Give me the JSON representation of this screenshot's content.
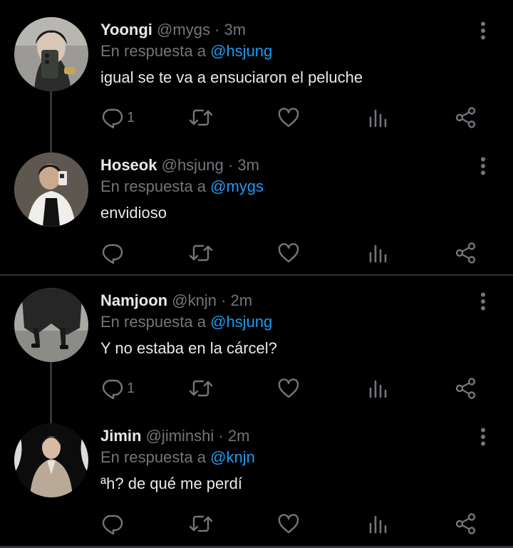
{
  "tweets": [
    {
      "name": "Yoongi",
      "handle": "@mygs",
      "dot": "·",
      "time": "3m",
      "reply_prefix": "En respuesta a",
      "reply_to": "@hsjung",
      "text": "igual se te va a ensuciaron el peluche",
      "reply_count": "1"
    },
    {
      "name": "Hoseok",
      "handle": "@hsjung",
      "dot": "·",
      "time": "3m",
      "reply_prefix": "En respuesta a",
      "reply_to": "@mygs",
      "text": "envidioso",
      "reply_count": ""
    },
    {
      "name": "Namjoon",
      "handle": "@knjn",
      "dot": "·",
      "time": "2m",
      "reply_prefix": "En respuesta a",
      "reply_to": "@hsjung",
      "text": "Y no estaba en la cárcel?",
      "reply_count": "1"
    },
    {
      "name": "Jimin",
      "handle": "@jiminshi",
      "dot": "·",
      "time": "2m",
      "reply_prefix": "En respuesta a",
      "reply_to": "@knjn",
      "text": "ªh? de qué me perdí",
      "reply_count": ""
    }
  ],
  "icons": {
    "reply": "reply-icon",
    "retweet": "retweet-icon",
    "like": "like-icon",
    "views": "views-icon",
    "share": "share-icon",
    "more": "more-vertical-icon"
  },
  "colors": {
    "background": "#000000",
    "text": "#e7e9ea",
    "muted": "#71767b",
    "link": "#1d9bf0",
    "divider": "#2f3336"
  }
}
